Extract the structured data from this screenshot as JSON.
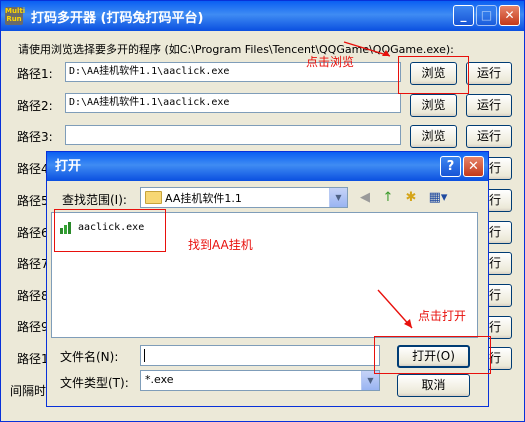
{
  "window": {
    "title": "打码多开器 (打码兔打码平台)",
    "icon_text": "Multi Run",
    "min_label": "_",
    "max_label": "□",
    "close_label": "✕"
  },
  "instruction": "请使用浏览选择要多开的程序 (如C:\\Program Files\\Tencent\\QQGame\\QQGame.exe):",
  "rows": [
    {
      "label": "路径1:",
      "value": "D:\\AA挂机软件1.1\\aaclick.exe",
      "browse": "浏览",
      "run": "运行"
    },
    {
      "label": "路径2:",
      "value": "D:\\AA挂机软件1.1\\aaclick.exe",
      "browse": "浏览",
      "run": "运行"
    },
    {
      "label": "路径3:",
      "value": "",
      "browse": "浏览",
      "run": "运行"
    },
    {
      "label": "路径4",
      "run": "运行"
    },
    {
      "label": "路径5",
      "run": "运行"
    },
    {
      "label": "路径6",
      "run": "运行"
    },
    {
      "label": "路径7",
      "run": "运行"
    },
    {
      "label": "路径8",
      "run": "运行"
    },
    {
      "label": "路径9",
      "run": "运行"
    },
    {
      "label": "路径10",
      "run": "运行"
    }
  ],
  "interval_label": "间隔时",
  "annotations": {
    "click_browse": "点击浏览",
    "find_aa": "找到AA挂机",
    "click_open": "点击打开"
  },
  "dialog": {
    "title": "打开",
    "help_label": "?",
    "close_label": "✕",
    "look_in_label": "查找范围(I):",
    "look_in_value": "AA挂机软件1.1",
    "file": "aaclick.exe",
    "filename_label": "文件名(N):",
    "filename_value": "",
    "filetype_label": "文件类型(T):",
    "filetype_value": "*.exe",
    "open_button": "打开(O)",
    "cancel_button": "取消"
  }
}
